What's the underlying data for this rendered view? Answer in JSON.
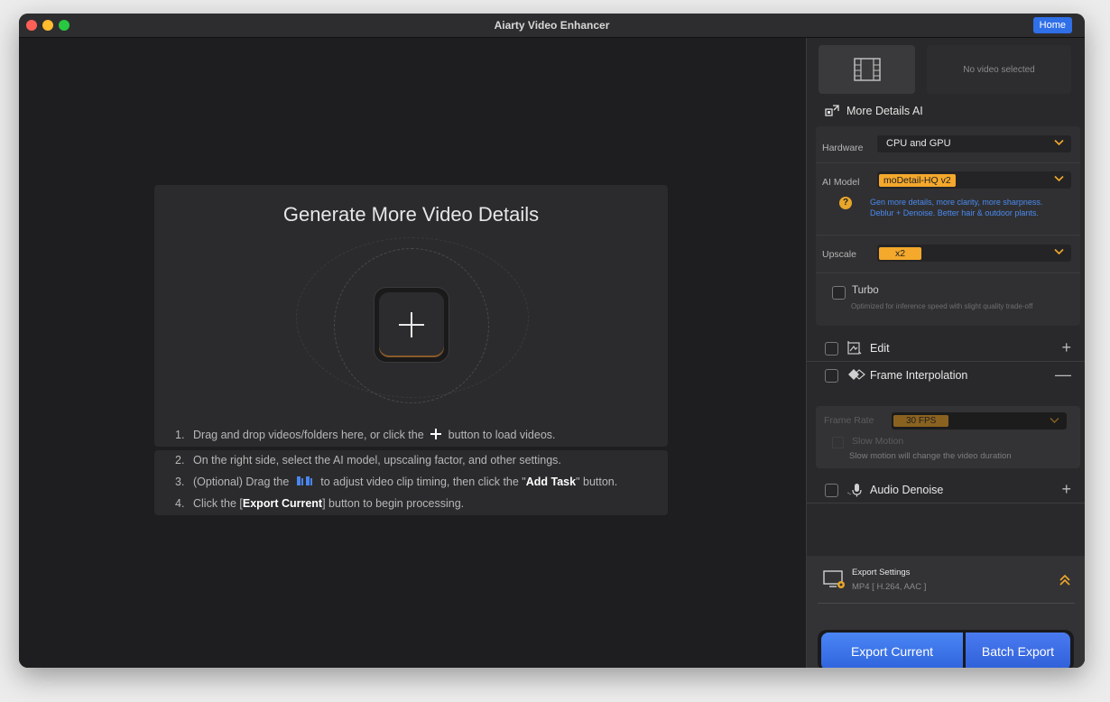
{
  "window": {
    "title": "Aiarty Video Enhancer",
    "home_label": "Home"
  },
  "main": {
    "drop_title": "Generate More Video Details",
    "steps": [
      {
        "num": "1.",
        "text_a": "Drag and drop videos/folders here, or click the",
        "text_b": "button to load videos."
      },
      {
        "num": "2.",
        "text": "On the right side, select the AI model, upscaling factor, and other settings."
      },
      {
        "num": "3.",
        "text_a": "(Optional) Drag the",
        "text_b": "to adjust video clip timing, then click the \"",
        "bold": "Add Task",
        "text_c": "\" button."
      },
      {
        "num": "4.",
        "text_a": "Click the [",
        "bold": "Export Current",
        "text_b": "] button to begin processing."
      }
    ]
  },
  "sidebar": {
    "no_video": "No video selected",
    "section_title": "More Details AI",
    "hardware": {
      "label": "Hardware",
      "value": "CPU and GPU"
    },
    "ai_model": {
      "label": "AI Model",
      "value": "moDetail-HQ  v2",
      "desc_1": "Gen more details, more clarity, more sharpness.",
      "desc_2": "Deblur + Denoise. Better hair & outdoor plants."
    },
    "upscale": {
      "label": "Upscale",
      "value": "x2"
    },
    "turbo": {
      "label": "Turbo",
      "hint": "Optimized for inference speed with slight quality trade-off"
    },
    "features": [
      {
        "label": "Edit",
        "end": "+"
      },
      {
        "label": "Frame Interpolation",
        "end": "—"
      },
      {
        "label": "Audio Denoise",
        "end": "+"
      }
    ],
    "frame_interp": {
      "rate_label": "Frame Rate",
      "rate_value": "30 FPS",
      "slow_label": "Slow Motion",
      "slow_hint": "Slow motion will change the video duration"
    },
    "export": {
      "title": "Export Settings",
      "format": "MP4 [ H.264, AAC ]",
      "export_current": "Export Current",
      "batch_export": "Batch Export"
    }
  },
  "colors": {
    "accent_blue": "#2f6fe8",
    "accent_orange": "#f4a82c",
    "link_blue": "#4a8af0"
  }
}
